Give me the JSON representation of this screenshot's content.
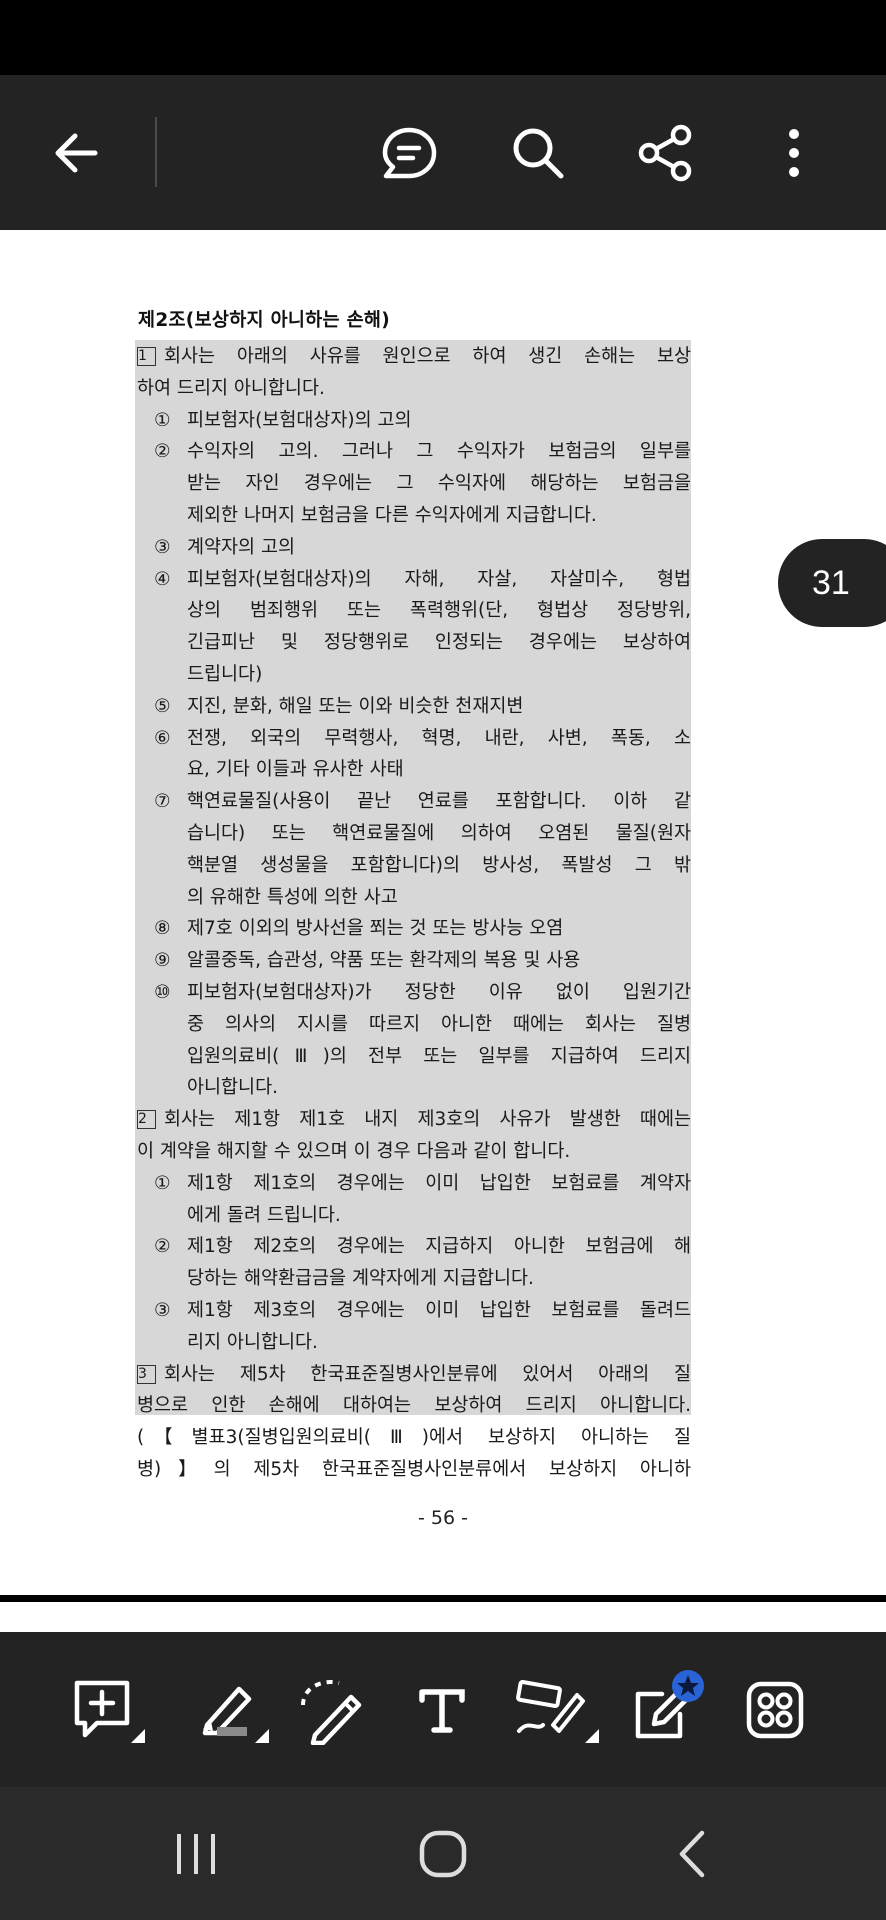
{
  "viewer": {
    "page_badge": "31",
    "page_number": "- 56 -"
  },
  "top_toolbar": {
    "back_icon": "arrow-left",
    "icons": [
      "comment-list-icon",
      "search-icon",
      "share-icon",
      "more-vert-icon"
    ]
  },
  "document": {
    "title": "제2조(보상하지 아니하는 손해)",
    "lines": [
      {
        "kind": "full-jf",
        "text": "회사는 아래의 사유를 원인으로 하여 생긴 손해는 보상",
        "box": "1"
      },
      {
        "kind": "full",
        "text": "하여 드리지 아니합니다."
      },
      {
        "kind": "item",
        "num": "①",
        "text": "피보험자(보험대상자)의 고의"
      },
      {
        "kind": "item-jf",
        "num": "②",
        "text": "수익자의 고의. 그러나 그 수익자가 보험금의 일부를"
      },
      {
        "kind": "cont-jf",
        "text": "받는 자인 경우에는 그 수익자에 해당하는 보험금을"
      },
      {
        "kind": "cont",
        "text": "제외한 나머지 보험금을 다른 수익자에게 지급합니다."
      },
      {
        "kind": "item",
        "num": "③",
        "text": "계약자의 고의"
      },
      {
        "kind": "item-jf",
        "num": "④",
        "text": "피보험자(보험대상자)의 자해, 자살, 자살미수, 형법"
      },
      {
        "kind": "cont-jf",
        "text": "상의 범죄행위 또는 폭력행위(단, 형법상 정당방위,"
      },
      {
        "kind": "cont-jf",
        "text": "긴급피난 및 정당행위로 인정되는 경우에는 보상하여"
      },
      {
        "kind": "cont",
        "text": "드립니다)"
      },
      {
        "kind": "item",
        "num": "⑤",
        "text": "지진, 분화, 해일 또는 이와 비슷한 천재지변"
      },
      {
        "kind": "item-jf",
        "num": "⑥",
        "text": "전쟁, 외국의 무력행사, 혁명, 내란, 사변, 폭동, 소"
      },
      {
        "kind": "cont",
        "text": "요, 기타 이들과 유사한 사태"
      },
      {
        "kind": "item-jf",
        "num": "⑦",
        "text": "핵연료물질(사용이 끝난 연료를 포함합니다. 이하 같"
      },
      {
        "kind": "cont-jf",
        "text": "습니다) 또는 핵연료물질에 의하여 오염된 물질(원자"
      },
      {
        "kind": "cont-jf",
        "text": "핵분열 생성물을 포함합니다)의 방사성, 폭발성 그 밖"
      },
      {
        "kind": "cont",
        "text": "의 유해한 특성에 의한 사고"
      },
      {
        "kind": "item",
        "num": "⑧",
        "text": "제7호 이외의 방사선을 쬐는 것 또는 방사능 오염"
      },
      {
        "kind": "item",
        "num": "⑨",
        "text": "알콜중독, 습관성, 약품 또는 환각제의 복용 및 사용"
      },
      {
        "kind": "item-jf",
        "num": "⑩",
        "text": "피보험자(보험대상자)가 정당한 이유 없이 입원기간"
      },
      {
        "kind": "cont-jf",
        "text": "중 의사의 지시를 따르지 아니한 때에는 회사는 질병"
      },
      {
        "kind": "cont-jf",
        "text": "입원의료비(Ⅲ)의 전부 또는 일부를 지급하여 드리지"
      },
      {
        "kind": "cont",
        "text": "아니합니다."
      },
      {
        "kind": "full-jf",
        "text": "회사는 제1항 제1호 내지 제3호의 사유가 발생한 때에는",
        "box": "2"
      },
      {
        "kind": "full",
        "text": "이 계약을 해지할 수 있으며 이 경우 다음과 같이 합니다."
      },
      {
        "kind": "item-jf",
        "num": "①",
        "text": "제1항 제1호의 경우에는 이미 납입한 보험료를 계약자"
      },
      {
        "kind": "cont",
        "text": "에게 돌려 드립니다."
      },
      {
        "kind": "item-jf",
        "num": "②",
        "text": "제1항 제2호의 경우에는 지급하지 아니한 보험금에 해"
      },
      {
        "kind": "cont",
        "text": "당하는 해약환급금을 계약자에게 지급합니다."
      },
      {
        "kind": "item-jf",
        "num": "③",
        "text": "제1항 제3호의 경우에는 이미 납입한 보험료를 돌려드"
      },
      {
        "kind": "cont",
        "text": "리지 아니합니다."
      },
      {
        "kind": "full-jf",
        "text": "회사는 제5차 한국표준질병사인분류에 있어서 아래의 질",
        "box": "3"
      },
      {
        "kind": "full-jf",
        "text": "병으로 인한 손해에 대하여는 보상하여 드리지 아니합니다."
      },
      {
        "kind": "full-jf",
        "text": "(【별표3(질병입원의료비(Ⅲ)에서 보상하지 아니하는 질"
      },
      {
        "kind": "full-jf",
        "text": "병)】의 제5차 한국표준질병사인분류에서 보상하지 아니하"
      }
    ]
  },
  "bottom_toolbar": {
    "icons": [
      "add-comment-icon",
      "highlighter-icon",
      "lasso-pen-icon",
      "text-icon",
      "signature-icon",
      "edit-note-icon",
      "apps-grid-icon"
    ]
  },
  "nav_bar": {
    "icons": [
      "recents-icon",
      "home-icon",
      "back-icon"
    ]
  }
}
